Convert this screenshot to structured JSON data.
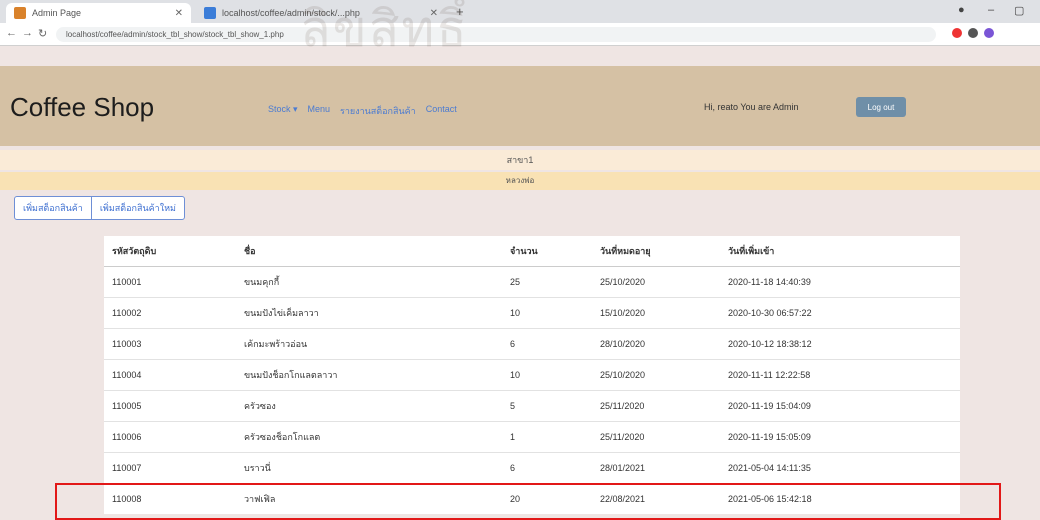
{
  "browser": {
    "active_tab": "Admin Page",
    "inactive_tab": "localhost/coffee/admin/stock/...php",
    "url": "localhost/coffee/admin/stock_tbl_show/stock_tbl_show_1.php"
  },
  "navbar": {
    "brand": "Coffee Shop",
    "links": [
      "Stock ▾",
      "Menu",
      "รายงานสต็อกสินค้า",
      "Contact"
    ],
    "greeting": "Hi, reato   You are Admin",
    "logout": "Log out"
  },
  "banners": {
    "line1": "สาขา1",
    "line2": "หลวงพ่อ"
  },
  "buttons": {
    "add_stock": "เพิ่มสต็อกสินค้า",
    "add_new": "เพิ่มสต็อกสินค้าใหม่"
  },
  "table": {
    "headers": [
      "รหัสวัตถุดิบ",
      "ชื่อ",
      "จำนวน",
      "วันที่หมดอายุ",
      "วันที่เพิ่มเข้า"
    ],
    "rows": [
      [
        "110001",
        "ขนมคุกกี้",
        "25",
        "25/10/2020",
        "2020-11-18 14:40:39"
      ],
      [
        "110002",
        "ขนมปังไข่เค็มลาวา",
        "10",
        "15/10/2020",
        "2020-10-30 06:57:22"
      ],
      [
        "110003",
        "เค้กมะพร้าวอ่อน",
        "6",
        "28/10/2020",
        "2020-10-12 18:38:12"
      ],
      [
        "110004",
        "ขนมปังช็อกโกแลตลาวา",
        "10",
        "25/10/2020",
        "2020-11-11 12:22:58"
      ],
      [
        "110005",
        "ครัวซอง",
        "5",
        "25/11/2020",
        "2020-11-19 15:04:09"
      ],
      [
        "110006",
        "ครัวซองช็อกโกแลต",
        "1",
        "25/11/2020",
        "2020-11-19 15:05:09"
      ],
      [
        "110007",
        "บราวนี่",
        "6",
        "28/01/2021",
        "2021-05-04 14:11:35"
      ],
      [
        "110008",
        "วาฟเฟิล",
        "20",
        "22/08/2021",
        "2021-05-06 15:42:18"
      ]
    ]
  },
  "watermark": "ลิขสิทธิ์มหาวิทยาลัยเชียงใหม่",
  "colors": {
    "navbar": "#d5c1a4",
    "highlight": "#e21818",
    "link": "#4b7bd1"
  }
}
